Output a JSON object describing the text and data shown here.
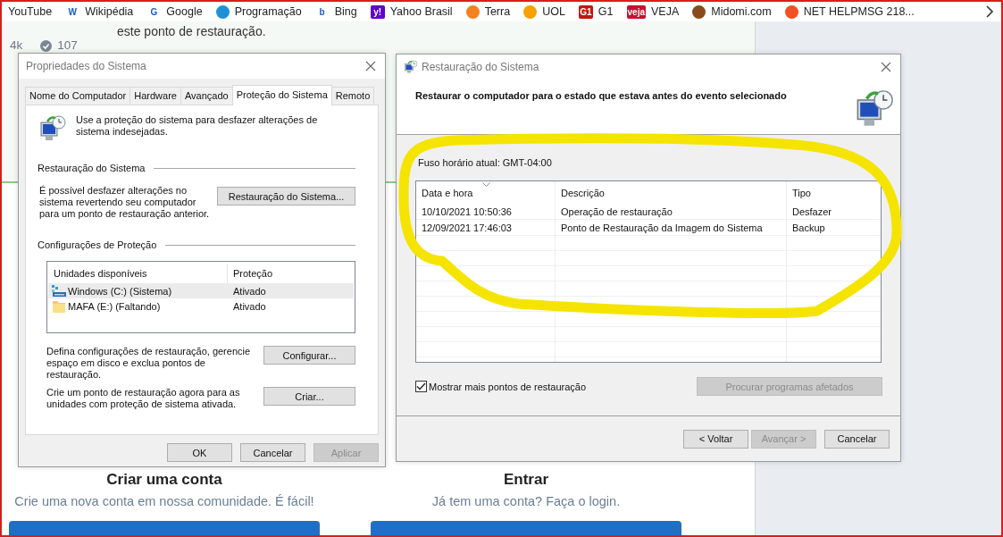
{
  "bookmarks": [
    {
      "label": "YouTube"
    },
    {
      "label": "Wikipédia",
      "logo": "W",
      "color": "#ffffff"
    },
    {
      "label": "Google",
      "logo": "G",
      "color": "#ffffff"
    },
    {
      "label": "Programação",
      "color": "#1e90d8"
    },
    {
      "label": "Bing",
      "logo": "b",
      "color": "#ffffff"
    },
    {
      "label": "Yahoo Brasil",
      "logo": "y!",
      "color": "#6001d2"
    },
    {
      "label": "Terra",
      "color": "#f5821f"
    },
    {
      "label": "UOL",
      "color": "#f7a200"
    },
    {
      "label": "G1",
      "logo": "G1",
      "color": "#c4170c"
    },
    {
      "label": "VEJA",
      "logo": "veja",
      "color": "#c8102e"
    },
    {
      "label": "Midomi.com",
      "color": "#8b4a1c"
    },
    {
      "label": "NET HELPMSG 218...",
      "color": "#f25022"
    }
  ],
  "page": {
    "snippet": "este ponto de restauração.",
    "stats": [
      {
        "kind": "text",
        "value": "4k"
      },
      {
        "kind": "check",
        "value": "107"
      }
    ],
    "signup": [
      {
        "title": "Criar uma conta",
        "subtitle": "Crie uma nova conta em nossa comunidade. É fácil!"
      },
      {
        "title": "Entrar",
        "subtitle": "Já tem uma conta? Faça o login."
      }
    ]
  },
  "properties_dialog": {
    "title": "Propriedades do Sistema",
    "tabs": [
      {
        "label": "Nome do Computador",
        "selected": false
      },
      {
        "label": "Hardware",
        "selected": false
      },
      {
        "label": "Avançado",
        "selected": false
      },
      {
        "label": "Proteção do Sistema",
        "selected": true
      },
      {
        "label": "Remoto",
        "selected": false
      }
    ],
    "intro": "Use a proteção do sistema para desfazer alterações de sistema indesejadas.",
    "restore_group": {
      "label": "Restauração do Sistema",
      "text": "É possível desfazer alterações no sistema revertendo seu computador para um ponto de restauração anterior.",
      "button": "Restauração do Sistema..."
    },
    "protection_group": {
      "label": "Configurações de Proteção",
      "columns": [
        "Unidades disponíveis",
        "Proteção"
      ],
      "drives": [
        {
          "kind": "drive",
          "name": "Windows (C:) (Sistema)",
          "protection": "Ativado",
          "selected": true
        },
        {
          "kind": "folder",
          "name": "MAFA (E:) (Faltando)",
          "protection": "Ativado",
          "selected": false
        }
      ],
      "actions": [
        {
          "text": "Defina configurações de restauração, gerencie espaço em disco e exclua pontos de restauração.",
          "button": "Configurar..."
        },
        {
          "text": "Crie um ponto de restauração agora para as unidades com proteção de sistema ativada.",
          "button": "Criar..."
        }
      ]
    },
    "buttons": [
      {
        "label": "OK",
        "disabled": false
      },
      {
        "label": "Cancelar",
        "disabled": false
      },
      {
        "label": "Aplicar",
        "disabled": true
      }
    ]
  },
  "restore_dialog": {
    "title": "Restauração do Sistema",
    "heading": "Restaurar o computador para o estado que estava antes do evento selecionado",
    "timezone": "Fuso horário atual: GMT-04:00",
    "columns": [
      "Data e hora",
      "Descrição",
      "Tipo"
    ],
    "rows": [
      {
        "date": "10/10/2021 10:50:36",
        "description": "Operação de restauração",
        "type": "Desfazer"
      },
      {
        "date": "12/09/2021 17:46:03",
        "description": "Ponto de Restauração da Imagem do Sistema",
        "type": "Backup"
      }
    ],
    "show_more": {
      "label": "Mostrar mais pontos de restauração",
      "checked": true
    },
    "scan_button": {
      "label": "Procurar programas afetados",
      "disabled": true
    },
    "buttons": [
      {
        "label": "< Voltar",
        "disabled": false
      },
      {
        "label": "Avançar >",
        "disabled": true
      },
      {
        "label": "Cancelar",
        "disabled": false
      }
    ]
  }
}
